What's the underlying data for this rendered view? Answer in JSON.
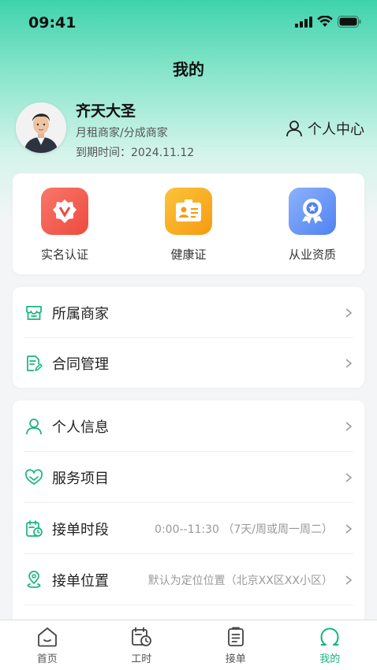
{
  "status_bar": {
    "time": "09:41"
  },
  "header": {
    "title": "我的"
  },
  "profile": {
    "name": "齐天大圣",
    "role": "月租商家/分成商家",
    "expire": "到期时间：2024.11.12",
    "personal_center_label": "个人中心"
  },
  "certs": [
    {
      "label": "实名认证",
      "icon": "verified-badge-icon",
      "color": "#f0584a"
    },
    {
      "label": "健康证",
      "icon": "health-card-icon",
      "color": "#f6a51c"
    },
    {
      "label": "从业资质",
      "icon": "qualification-award-icon",
      "color": "#5b8ef5"
    }
  ],
  "group1": [
    {
      "label": "所属商家",
      "icon": "store-icon"
    },
    {
      "label": "合同管理",
      "icon": "contract-icon"
    }
  ],
  "group2": [
    {
      "label": "个人信息",
      "icon": "person-icon",
      "value": ""
    },
    {
      "label": "服务项目",
      "icon": "service-heart-icon",
      "value": ""
    },
    {
      "label": "接单时段",
      "icon": "schedule-icon",
      "value": "0:00--11:30 （7天/周或周一周二）"
    },
    {
      "label": "接单位置",
      "icon": "location-icon",
      "value": "默认为定位位置（北京XX区XX小区）"
    }
  ],
  "tabs": [
    {
      "label": "首页",
      "icon": "home-icon"
    },
    {
      "label": "工时",
      "icon": "work-hours-icon"
    },
    {
      "label": "接单",
      "icon": "orders-icon"
    },
    {
      "label": "我的",
      "icon": "profile-tab-icon",
      "active": true
    }
  ],
  "colors": {
    "accent": "#15b57f",
    "hero_top": "#3ed3ac"
  }
}
